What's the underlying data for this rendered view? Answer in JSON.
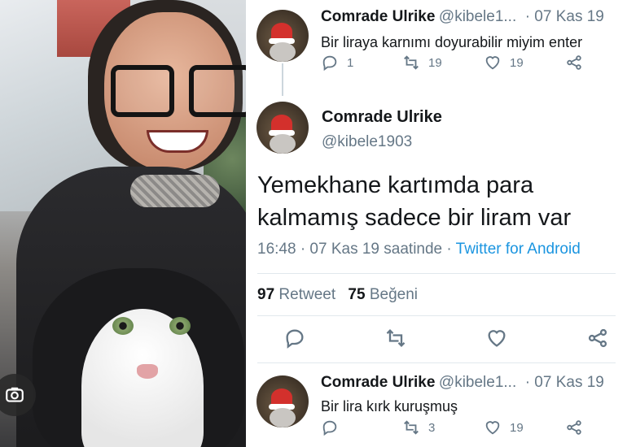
{
  "tweets": [
    {
      "name": "Comrade Ulrike",
      "handle": "@kibele1...",
      "date": "· 07 Kas 19",
      "text": "Bir liraya karnımı doyurabilir miyim enter",
      "replies": "1",
      "retweets": "19",
      "likes": "19"
    },
    {
      "name": "Comrade Ulrike",
      "handle": "@kibele1903",
      "text": "Yemekhane kartımda para kalmamış sadece bir liram var",
      "time": "16:48 · 07 Kas 19 saatinde · ",
      "client": "Twitter for Android",
      "retweet_count": "97",
      "retweet_label": "Retweet",
      "like_count": "75",
      "like_label": "Beğeni"
    },
    {
      "name": "Comrade Ulrike",
      "handle": "@kibele1...",
      "date": "· 07 Kas 19",
      "text": "Bir lira kırk kuruşmuş",
      "retweets": "3",
      "likes": "19"
    }
  ],
  "colors": {
    "link": "#1b95e0",
    "muted": "#657786",
    "text": "#14171a",
    "hat": "#d3302c"
  },
  "icons": [
    "reply-icon",
    "retweet-icon",
    "like-icon",
    "share-icon",
    "lens-icon"
  ]
}
